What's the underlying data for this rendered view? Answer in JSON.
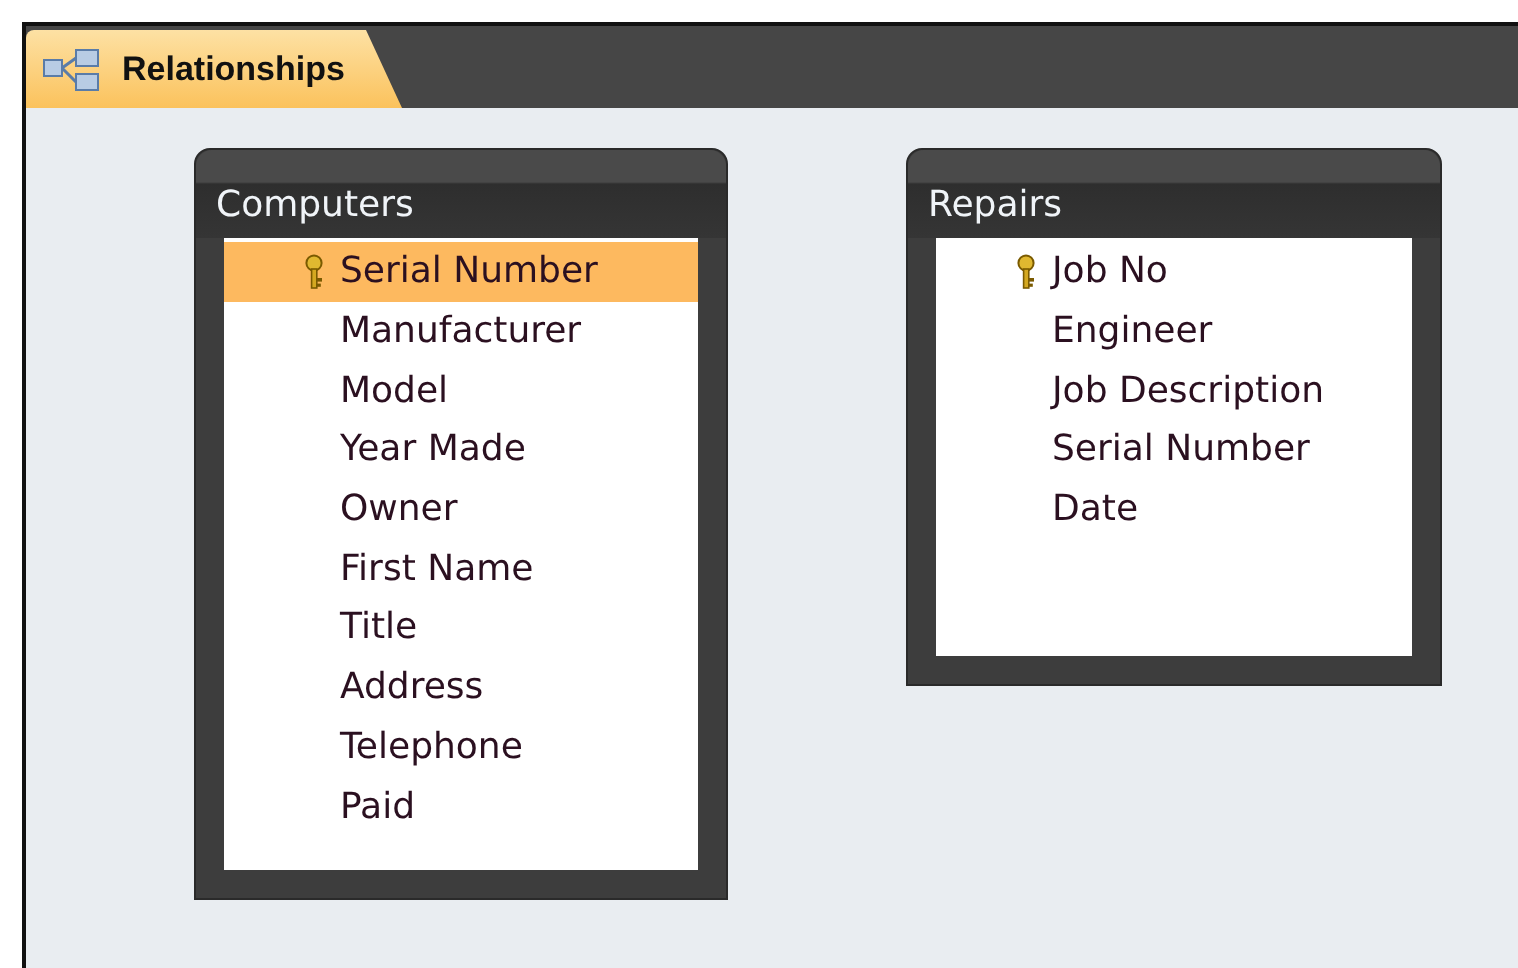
{
  "tab": {
    "label": "Relationships",
    "selected": true
  },
  "tables": [
    {
      "title": "Computers",
      "fields": [
        {
          "name": "Serial Number",
          "key": true,
          "selected": true
        },
        {
          "name": "Manufacturer",
          "key": false,
          "selected": false
        },
        {
          "name": "Model",
          "key": false,
          "selected": false
        },
        {
          "name": "Year Made",
          "key": false,
          "selected": false
        },
        {
          "name": "Owner",
          "key": false,
          "selected": false
        },
        {
          "name": "First Name",
          "key": false,
          "selected": false
        },
        {
          "name": "Title",
          "key": false,
          "selected": false
        },
        {
          "name": "Address",
          "key": false,
          "selected": false
        },
        {
          "name": "Telephone",
          "key": false,
          "selected": false
        },
        {
          "name": "Paid",
          "key": false,
          "selected": false
        }
      ]
    },
    {
      "title": "Repairs",
      "fields": [
        {
          "name": "Job No",
          "key": true,
          "selected": false
        },
        {
          "name": "Engineer",
          "key": false,
          "selected": false
        },
        {
          "name": "Job Description",
          "key": false,
          "selected": false
        },
        {
          "name": "Serial Number",
          "key": false,
          "selected": false
        },
        {
          "name": "Date",
          "key": false,
          "selected": false
        }
      ]
    }
  ]
}
